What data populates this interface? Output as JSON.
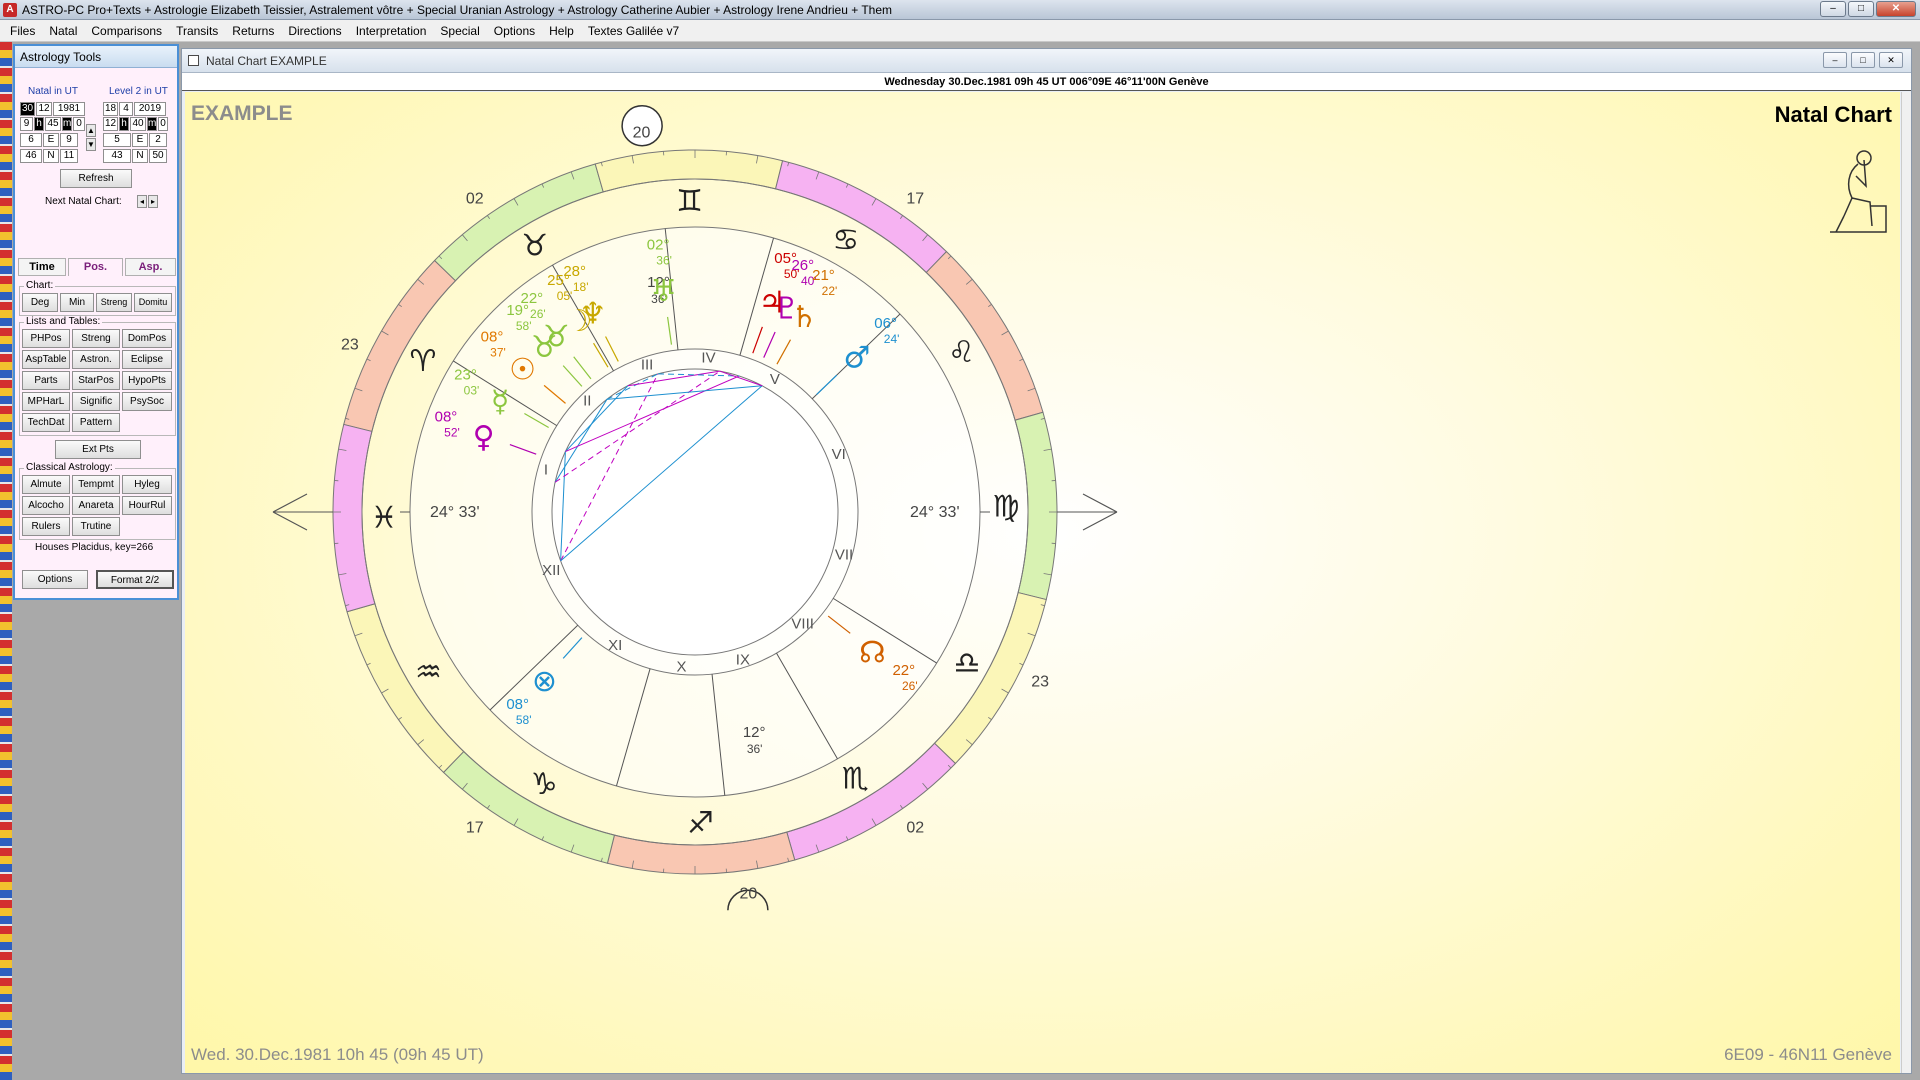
{
  "titlebar": {
    "app_icon": "A",
    "title": "ASTRO-PC Pro+Texts + Astrologie Elizabeth Teissier, Astralement vôtre + Special Uranian Astrology + Astrology Catherine Aubier + Astrology Irene Andrieu + Them",
    "min_glyph": "–",
    "max_glyph": "□",
    "close_glyph": "✕"
  },
  "menu": [
    "Files",
    "Natal",
    "Comparisons",
    "Transits",
    "Returns",
    "Directions",
    "Interpretation",
    "Special",
    "Options",
    "Help",
    "Textes Galilée v7"
  ],
  "tools": {
    "title": "Astrology Tools",
    "natal_label": "Natal in UT",
    "level2_label": "Level 2 in UT",
    "natal": {
      "day": "30",
      "month": "12",
      "year": "1981",
      "hour": "9",
      "h": "h",
      "min": "45",
      "m": "m",
      "sec": "0",
      "lon_deg": "6",
      "lon_dir": "E",
      "lon_min": "9",
      "lat_deg": "46",
      "lat_dir": "N",
      "lat_min": "11"
    },
    "level2": {
      "day": "18",
      "month": "4",
      "year": "2019",
      "hour": "12",
      "h": "h",
      "min": "40",
      "m": "m",
      "sec": "0",
      "lon_deg": "5",
      "lon_dir": "E",
      "lon_min": "2",
      "lat_deg": "43",
      "lat_dir": "N",
      "lat_min": "50"
    },
    "refresh": "Refresh",
    "next_natal": "Next Natal Chart:",
    "tabs": [
      "Time",
      "Pos.",
      "Asp."
    ],
    "chart_group": "Chart:",
    "chart_buttons": [
      "Deg",
      "Min",
      "Streng",
      "Domitu"
    ],
    "lists_group": "Lists and Tables:",
    "lists_buttons": [
      "PHPos",
      "Streng",
      "DomPos",
      "AspTable",
      "Astron.",
      "Eclipse",
      "Parts",
      "StarPos",
      "HypoPts",
      "MPHarL",
      "Signific",
      "PsySoc",
      "TechDat",
      "Pattern",
      ""
    ],
    "ext_pts": "Ext Pts",
    "classical_group": "Classical Astrology:",
    "classical_buttons": [
      "Almute",
      "Tempmt",
      "Hyleg",
      "Alcocho",
      "Anareta",
      "HourRul",
      "Rulers",
      "Trutine"
    ],
    "houses": "Houses Placidus, key=266",
    "options": "Options",
    "format": "Format 2/2"
  },
  "chartwin": {
    "title": "Natal Chart  EXAMPLE",
    "info": "Wednesday 30.Dec.1981 09h 45 UT 006°09E 46°11'00N  Genève",
    "name": "EXAMPLE",
    "kind": "Natal Chart",
    "footer_left": "Wed. 30.Dec.1981 10h 45 (09h 45 UT)",
    "footer_right": "6E09 - 46N11  Genève",
    "asc_label": "24° 33'",
    "dsc_label": "24° 33'",
    "mc_label": "12°",
    "mc_min": "36'",
    "ic_label": "12°",
    "ic_min": "36'",
    "cusp_labels": [
      "20",
      "17",
      "23",
      "02",
      "20",
      "17",
      "23",
      "02"
    ],
    "house_numerals": [
      "I",
      "II",
      "III",
      "IV",
      "V",
      "VI",
      "VII",
      "VIII",
      "IX",
      "X",
      "XI",
      "XII"
    ],
    "planets": [
      {
        "glyph": "☉",
        "deg": "08°",
        "min": "37'",
        "color": "#e07800"
      },
      {
        "glyph": "☽",
        "deg": "25°",
        "min": "05'",
        "color": "#c8a800"
      },
      {
        "glyph": "♆",
        "deg": "28°",
        "min": "18'",
        "color": "#c8a800"
      },
      {
        "glyph": "♅",
        "deg": "02°",
        "min": "36'",
        "color": "#8cc63f"
      },
      {
        "glyph": "♃",
        "deg": "05°",
        "min": "50'",
        "color": "#cc0000"
      },
      {
        "glyph": "♇",
        "deg": "26°",
        "min": "40'",
        "color": "#b000b0"
      },
      {
        "glyph": "♄",
        "deg": "21°",
        "min": "22'",
        "color": "#d07000"
      },
      {
        "glyph": "♂",
        "deg": "06°",
        "min": "24'",
        "color": "#1e90d0"
      },
      {
        "glyph": "☊",
        "deg": "22°",
        "min": "26'",
        "color": "#d06000"
      },
      {
        "glyph": "⊗",
        "deg": "08°",
        "min": "58'",
        "color": "#1e90d0"
      },
      {
        "glyph": "♀",
        "deg": "08°",
        "min": "52'",
        "color": "#b000b0"
      },
      {
        "glyph": "☿",
        "deg": "23°",
        "min": "03'",
        "color": "#8cc63f"
      },
      {
        "glyph": "♉",
        "deg": "19°",
        "min": "58'",
        "color": "#8cc63f"
      },
      {
        "glyph": "♉",
        "deg": "22°",
        "min": "26'",
        "color": "#8cc63f"
      }
    ],
    "signs": [
      "♈",
      "♉",
      "♊",
      "♋",
      "♌",
      "♍",
      "♎",
      "♏",
      "♐",
      "♑",
      "♒",
      "♓"
    ]
  }
}
